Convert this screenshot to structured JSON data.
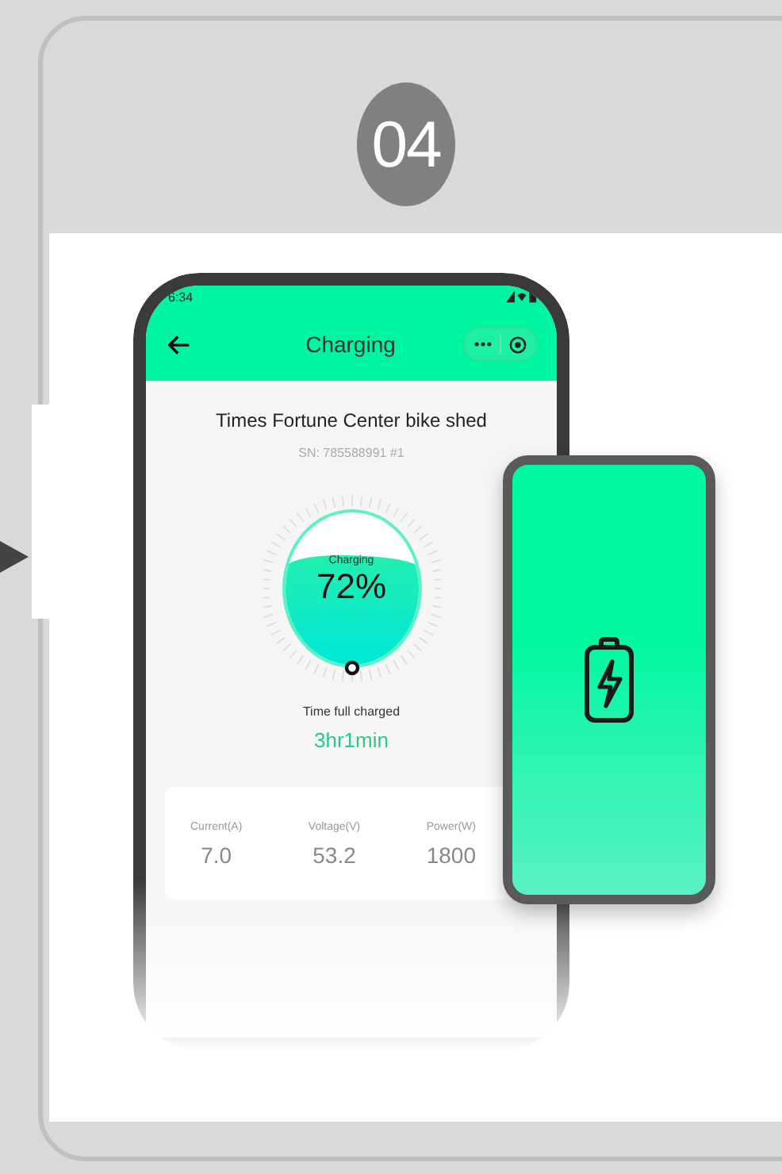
{
  "step": {
    "number": "04"
  },
  "phone": {
    "status_time": "6:34",
    "title": "Charging",
    "station": "Times Fortune Center bike shed",
    "serial": "SN: 785588991 #1",
    "gauge": {
      "label": "Charging",
      "reading": "72%",
      "level": 0.72
    },
    "remaining_label": "Time full charged",
    "remaining": "3hr1min",
    "stats": [
      {
        "label": "Current(A)",
        "value": "7.0"
      },
      {
        "label": "Voltage(V)",
        "value": "53.2"
      },
      {
        "label": "Power(W)",
        "value": "1800"
      }
    ]
  }
}
